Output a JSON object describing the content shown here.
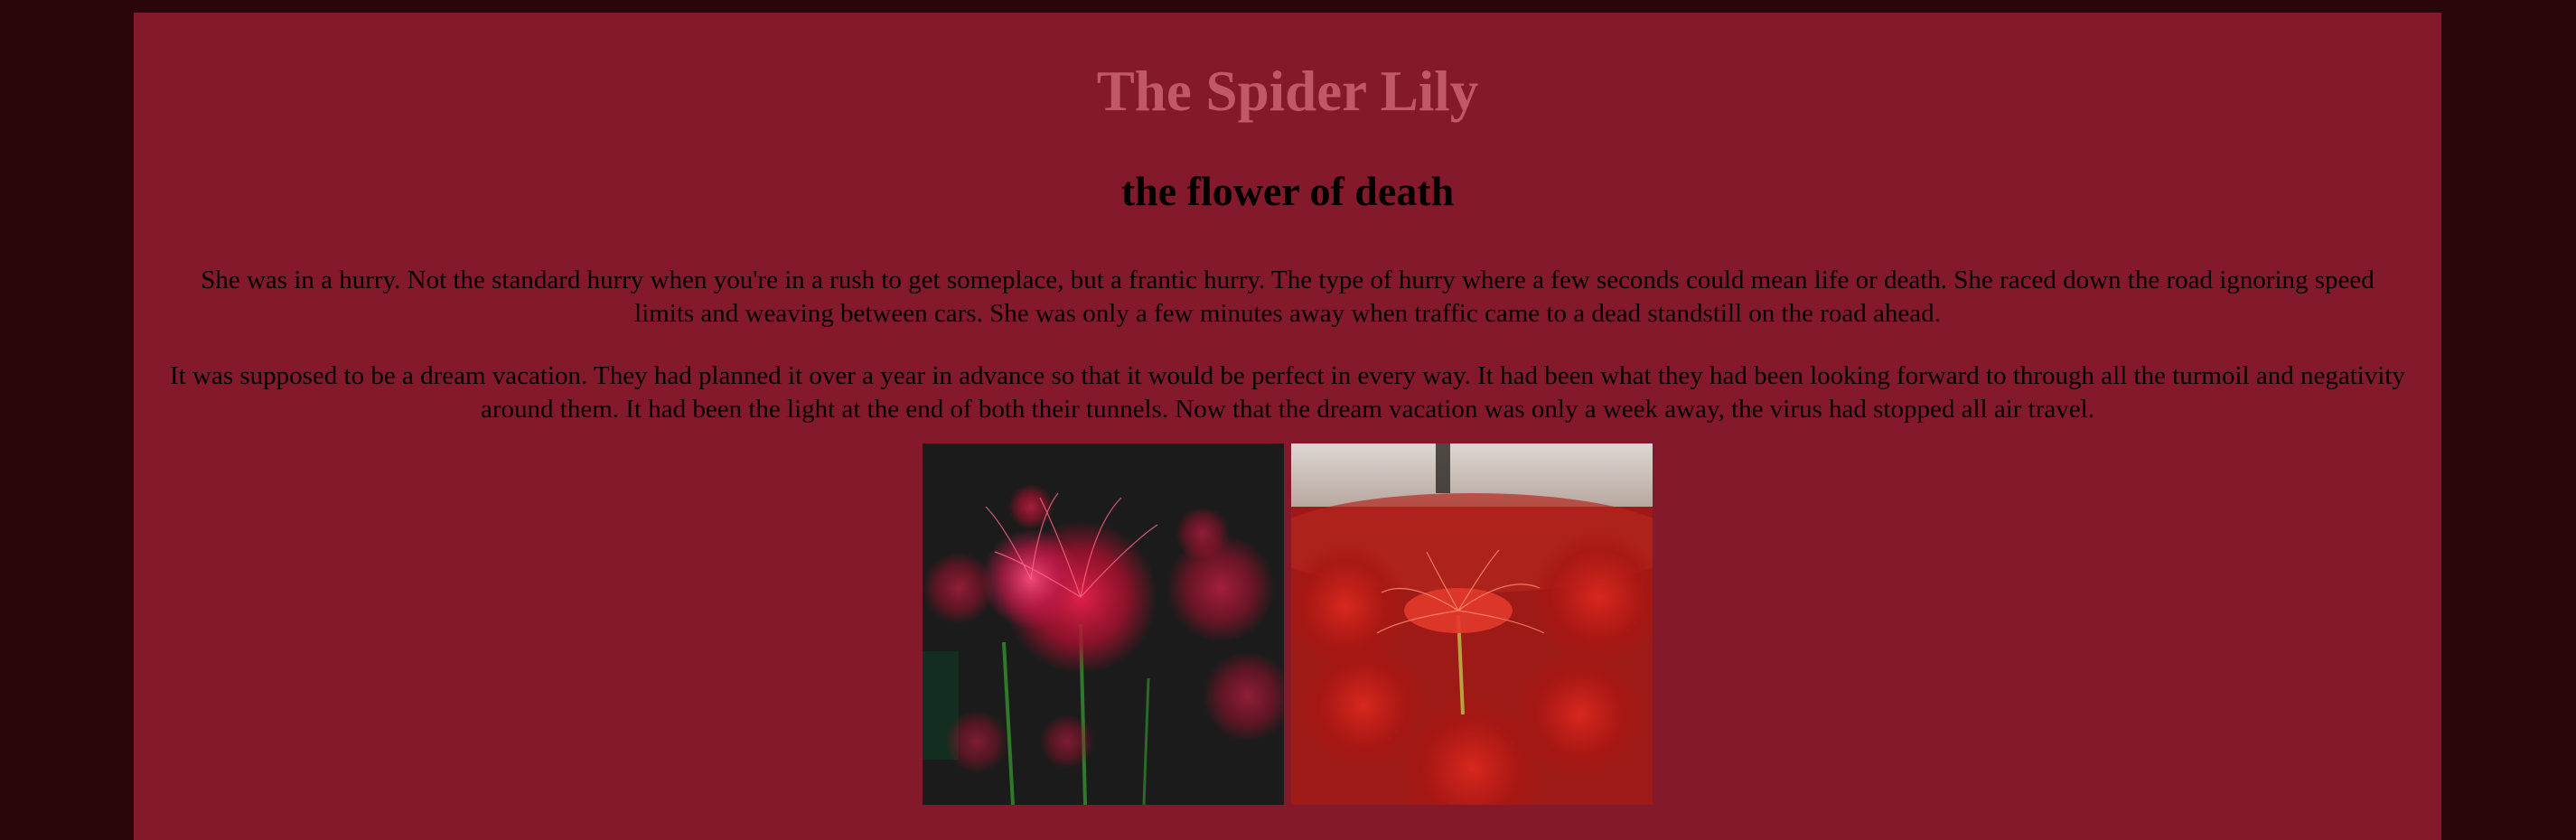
{
  "page": {
    "title": "The Spider Lily",
    "subtitle": "the flower of death",
    "paragraphs": [
      "She was in a hurry. Not the standard hurry when you're in a rush to get someplace, but a frantic hurry. The type of hurry where a few seconds could mean life or death. She raced down the road ignoring speed limits and weaving between cars. She was only a few minutes away when traffic came to a dead standstill on the road ahead.",
      "It was supposed to be a dream vacation. They had planned it over a year in advance so that it would be perfect in every way. It had been what they had been looking forward to through all the turmoil and negativity around them. It had been the light at the end of both their tunnels. Now that the dream vacation was only a week away, the virus had stopped all air travel."
    ]
  },
  "images": [
    {
      "subject": "red spider lilies against a dark background"
    },
    {
      "subject": "field of red spider lilies, close-up"
    }
  ],
  "colors": {
    "outer_background": "#2a0509",
    "page_background": "#83192a",
    "title": "#c05869",
    "text": "#000000"
  }
}
